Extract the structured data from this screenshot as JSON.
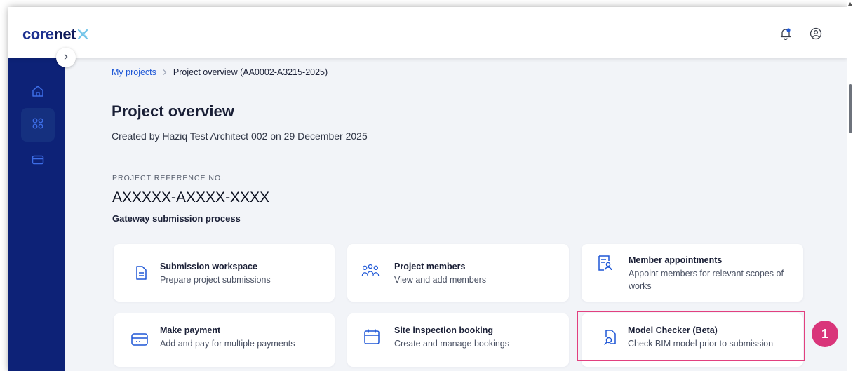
{
  "header": {
    "logo_part1": "core",
    "logo_part2": "net",
    "icons": [
      "bell-icon",
      "user-icon"
    ]
  },
  "sidebar": {
    "items": [
      {
        "name": "home",
        "icon": "home-icon"
      },
      {
        "name": "projects",
        "icon": "grid-icon",
        "active": true
      },
      {
        "name": "payments",
        "icon": "card-icon"
      }
    ]
  },
  "breadcrumb": {
    "parent": "My projects",
    "current": "Project overview (AA0002-A3215-2025)"
  },
  "page": {
    "title": "Project overview",
    "subtitle": "Created by Haziq Test Architect 002 on 29 December 2025",
    "ref_label": "PROJECT REFERENCE NO.",
    "ref_value": "AXXXXX-AXXXX-XXXX",
    "process_label": "Gateway submission process"
  },
  "cards": [
    {
      "title": "Submission workspace",
      "desc": "Prepare project submissions",
      "icon": "document-icon"
    },
    {
      "title": "Project members",
      "desc": "View and add members",
      "icon": "users-icon"
    },
    {
      "title": "Member appointments",
      "desc": "Appoint members for relevant scopes of works",
      "icon": "appointment-icon"
    },
    {
      "title": "Make payment",
      "desc": "Add and pay for multiple payments",
      "icon": "card-icon"
    },
    {
      "title": "Site inspection booking",
      "desc": "Create and manage bookings",
      "icon": "calendar-icon"
    },
    {
      "title": "Model Checker (Beta)",
      "desc": "Check BIM model prior to submission",
      "icon": "file-search-icon"
    }
  ],
  "annotation": {
    "step": "1"
  },
  "colors": {
    "sidebar": "#0d2277",
    "accent": "#1e57d6",
    "highlight": "#e2407f"
  }
}
